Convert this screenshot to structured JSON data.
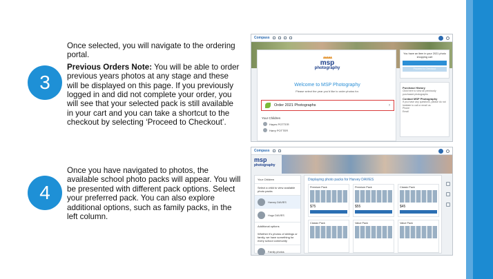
{
  "steps": [
    {
      "number": "3",
      "paragraph1": "Once selected, you will navigate to the ordering portal.",
      "note_heading": "Previous Orders Note:",
      "note_body": " You will be able to order previous years photos at any stage and these will be displayed on this page. If you previously logged in and did not complete your order, you will see that your selected pack is still available in your cart and you can take a shortcut to the checkout by selecting ‘Proceed to Checkout’."
    },
    {
      "number": "4",
      "paragraph1": "Once you have navigated to photos, the available school photo packs will appear. You will be presented with different pack options. Select your preferred pack. You can also explore additional options, such as family packs, in the left column."
    }
  ],
  "screenshot1": {
    "app_name": "Compass",
    "logo_line1": "msp",
    "logo_line2": "photography",
    "welcome_title": "Welcome to MSP Photography",
    "welcome_sub": "Please select the year you'd like to order photos for.",
    "order_item": "Order 2021 Photographs",
    "children_label": "Your Children",
    "children": [
      "Hayes POTTER",
      "Harry POTTER"
    ],
    "cart_text": "You have an item in your 2021 photo shopping cart",
    "cart_button": "Proceed to Checkout",
    "info": [
      {
        "heading": "Purchase History",
        "text": "Click here to view all previously purchased photographs"
      },
      {
        "heading": "Contact MSP Photography",
        "text": "If you have any questions, please do not hesitate to call or email us."
      }
    ],
    "contact_labels": [
      "Phone",
      "Email"
    ]
  },
  "screenshot2": {
    "app_name": "Compass",
    "logo_line1": "msp",
    "logo_line2": "photography",
    "main_title": "Displaying photo packs for Harvey DAVIES",
    "left_heading": "Your Children",
    "left_sub": "Select a child to view available photo packs",
    "children": [
      "Harvey DAVIES",
      "Hugo DAVIES"
    ],
    "additional_heading": "Additional options",
    "additional_sub": "Whether it's photos of siblings or family, we have something for every school community",
    "family_option": "Family photos",
    "packs": [
      {
        "name": "Premium Pack",
        "price": "$75"
      },
      {
        "name": "Premium Pack",
        "price": "$55"
      },
      {
        "name": "Classic Pack",
        "price": "$45"
      },
      {
        "name": "Classic Pack",
        "price": ""
      },
      {
        "name": "Value Pack",
        "price": ""
      },
      {
        "name": "Value Pack",
        "price": ""
      }
    ]
  }
}
